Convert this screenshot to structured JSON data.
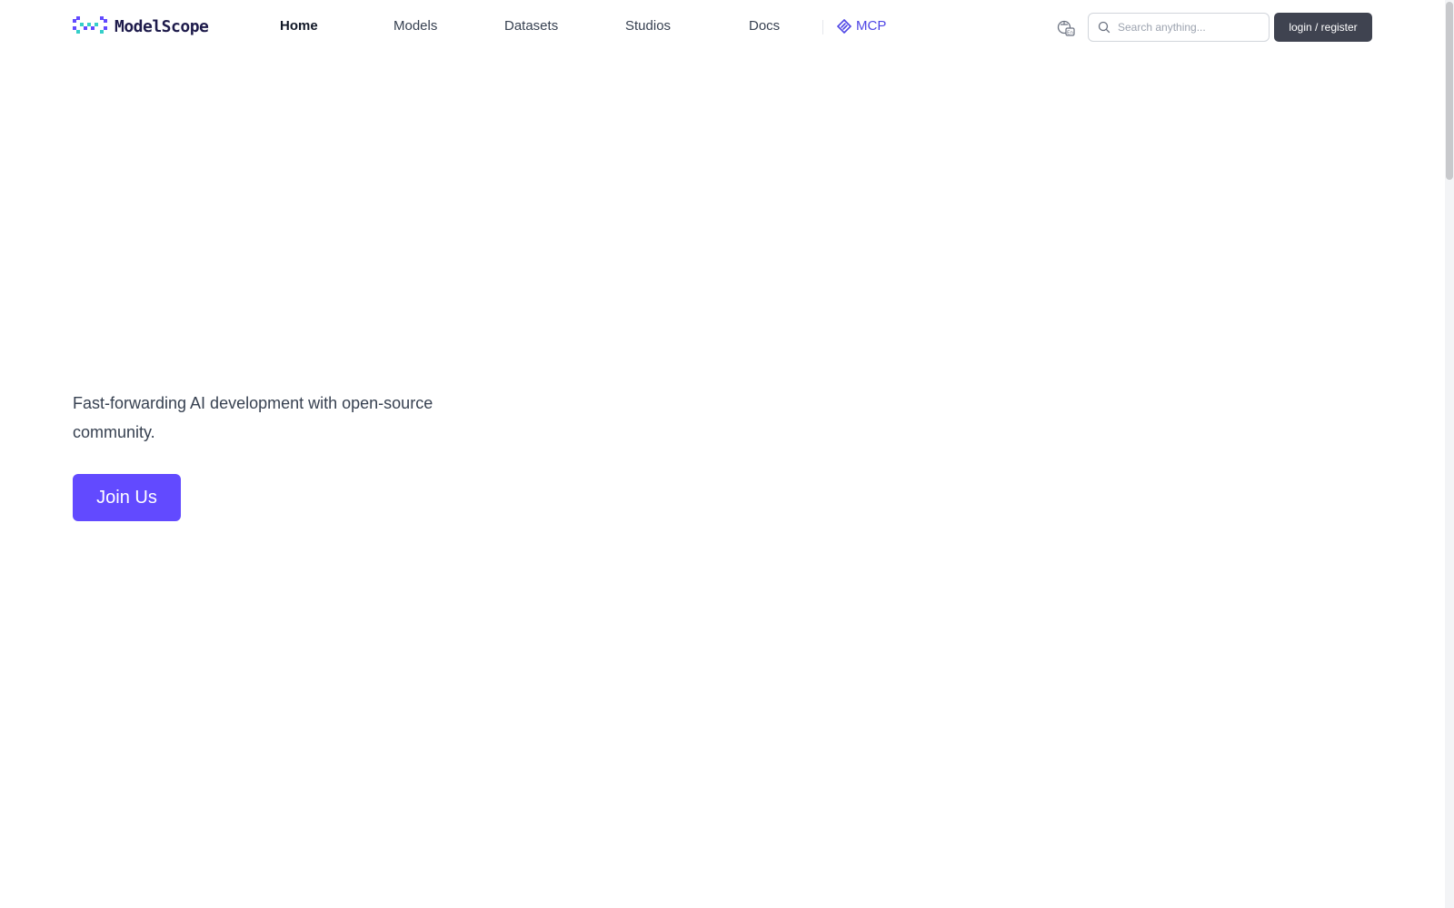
{
  "header": {
    "logo_text": "ModelScope",
    "nav": [
      {
        "label": "Home",
        "active": true
      },
      {
        "label": "Models",
        "active": false
      },
      {
        "label": "Datasets",
        "active": false
      },
      {
        "label": "Studios",
        "active": false
      },
      {
        "label": "Docs",
        "active": false
      }
    ],
    "mcp_label": "MCP",
    "language_icon": "language-icon",
    "search": {
      "placeholder": "Search anything...",
      "value": ""
    },
    "login_label": "login / register"
  },
  "hero": {
    "tagline": "Fast-forwarding AI development with open-source community.",
    "join_label": "Join Us"
  },
  "colors": {
    "brand": "#624aff",
    "mcp": "#4f46e5",
    "login_bg": "#3f4350"
  }
}
